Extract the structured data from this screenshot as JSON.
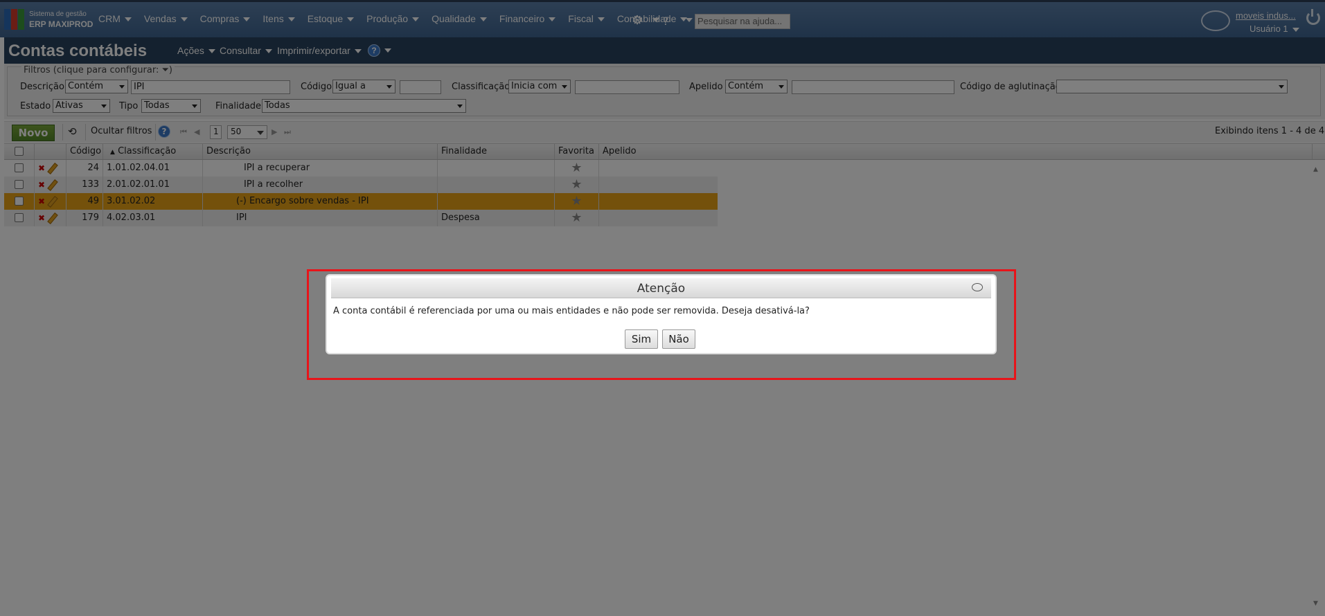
{
  "topbar": {
    "logo_line1": "Sistema de gestão",
    "logo_line2": "ERP MAXIPROD",
    "menu": [
      "CRM",
      "Vendas",
      "Compras",
      "Itens",
      "Estoque",
      "Produção",
      "Qualidade",
      "Financeiro",
      "Fiscal",
      "Contabilidade"
    ],
    "help_placeholder": "Pesquisar na ajuda...",
    "company": "moveis indus...",
    "user": "Usuário 1",
    "colors": {
      "bar": "#4a6f98",
      "logo": [
        "#2a6ab8",
        "#d63a2a",
        "#3a9a3a"
      ]
    }
  },
  "titlebar": {
    "title": "Contas contábeis",
    "menu": [
      "Ações",
      "Consultar",
      "Imprimir/exportar"
    ],
    "help_label": "?"
  },
  "filters": {
    "legend": "Filtros (clique para configurar:",
    "legend_end": ")",
    "descricao_label": "Descrição",
    "descricao_op": "Contém",
    "descricao_value": "IPI",
    "codigo_label": "Código",
    "codigo_op": "Igual a",
    "classificacao_label": "Classificação",
    "classificacao_op": "Inicia com",
    "apelido_label": "Apelido",
    "apelido_op": "Contém",
    "aglutinacao_label": "Código de aglutinação",
    "estado_label": "Estado",
    "estado_value": "Ativas",
    "tipo_label": "Tipo",
    "tipo_value": "Todas",
    "finalidade_label": "Finalidade",
    "finalidade_value": "Todas"
  },
  "toolbar": {
    "novo": "Novo",
    "hide_filters": "Ocultar filtros",
    "help_label": "?",
    "page": "1",
    "page_size": "50",
    "status": "Exibindo itens 1 - 4 de 4"
  },
  "grid": {
    "columns": [
      "Código",
      "Classificação",
      "Descrição",
      "Finalidade",
      "Favorita",
      "Apelido"
    ],
    "rows": [
      {
        "codigo": "24",
        "classificacao": "1.01.02.04.01",
        "descricao": "IPI a recuperar",
        "finalidade": ""
      },
      {
        "codigo": "133",
        "classificacao": "2.01.02.01.01",
        "descricao": "IPI a recolher",
        "finalidade": ""
      },
      {
        "codigo": "49",
        "classificacao": "3.01.02.02",
        "descricao": "(-) Encargo sobre vendas - IPI",
        "finalidade": ""
      },
      {
        "codigo": "179",
        "classificacao": "4.02.03.01",
        "descricao": "IPI",
        "finalidade": "Despesa"
      }
    ],
    "selected_row_color": "#e8a317"
  },
  "dialog": {
    "title": "Atenção",
    "message": "A conta contábil é referenciada por uma ou mais entidades e não pode ser removida. Deseja desativá-la?",
    "yes": "Sim",
    "no": "Não",
    "highlight_color": "#e8141a"
  }
}
